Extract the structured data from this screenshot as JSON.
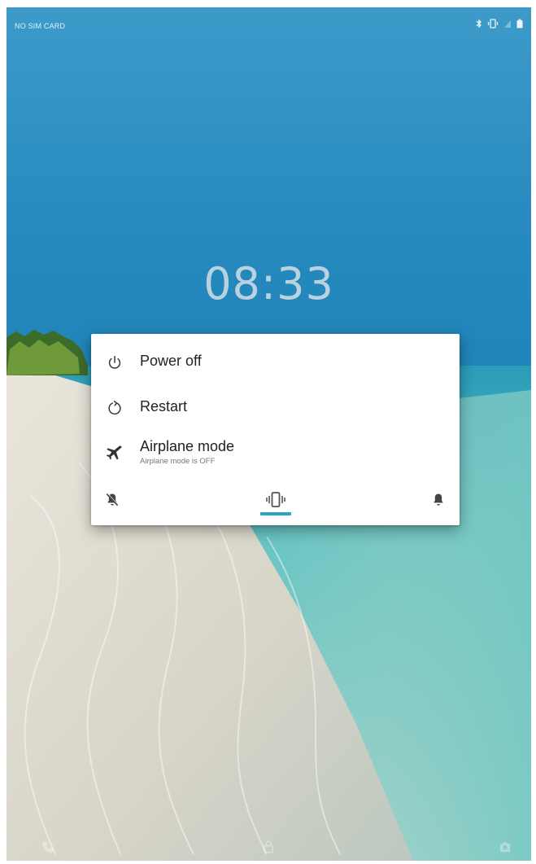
{
  "status_bar": {
    "carrier": "NO SIM CARD",
    "icons": [
      "bluetooth-icon",
      "vibrate-icon",
      "signal-icon",
      "battery-icon"
    ]
  },
  "lockscreen": {
    "time": "08:33"
  },
  "power_menu": {
    "items": [
      {
        "id": "power-off",
        "label": "Power off",
        "icon": "power-icon"
      },
      {
        "id": "restart",
        "label": "Restart",
        "icon": "restart-icon"
      },
      {
        "id": "airplane",
        "label": "Airplane mode",
        "sublabel": "Airplane mode is OFF",
        "icon": "airplane-icon"
      }
    ],
    "ringer": {
      "options": [
        "silent",
        "vibrate",
        "sound"
      ],
      "selected": "vibrate"
    }
  },
  "colors": {
    "accent": "#2aa3c7",
    "sky": "#2e8fbf",
    "dialog_bg": "#ffffff"
  }
}
